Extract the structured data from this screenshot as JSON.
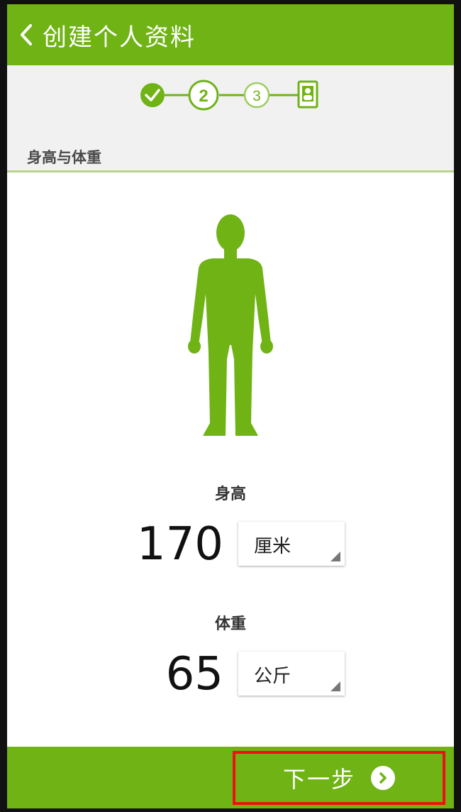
{
  "header": {
    "title": "创建个人资料",
    "back_icon": "chevron-left-icon"
  },
  "stepper": {
    "steps": [
      {
        "state": "done",
        "icon": "check-icon"
      },
      {
        "label": "2",
        "state": "current"
      },
      {
        "label": "3",
        "state": "pending"
      },
      {
        "state": "pending",
        "icon": "profile-card-icon"
      }
    ]
  },
  "section": {
    "title": "身高与体重"
  },
  "height": {
    "label": "身高",
    "value": "170",
    "unit": "厘米"
  },
  "weight": {
    "label": "体重",
    "value": "65",
    "unit": "公斤"
  },
  "footer": {
    "next_label": "下一步",
    "next_icon": "chevron-right-circle-icon"
  },
  "colors": {
    "brand": "#6fb315",
    "highlight_border": "#ee1111"
  }
}
